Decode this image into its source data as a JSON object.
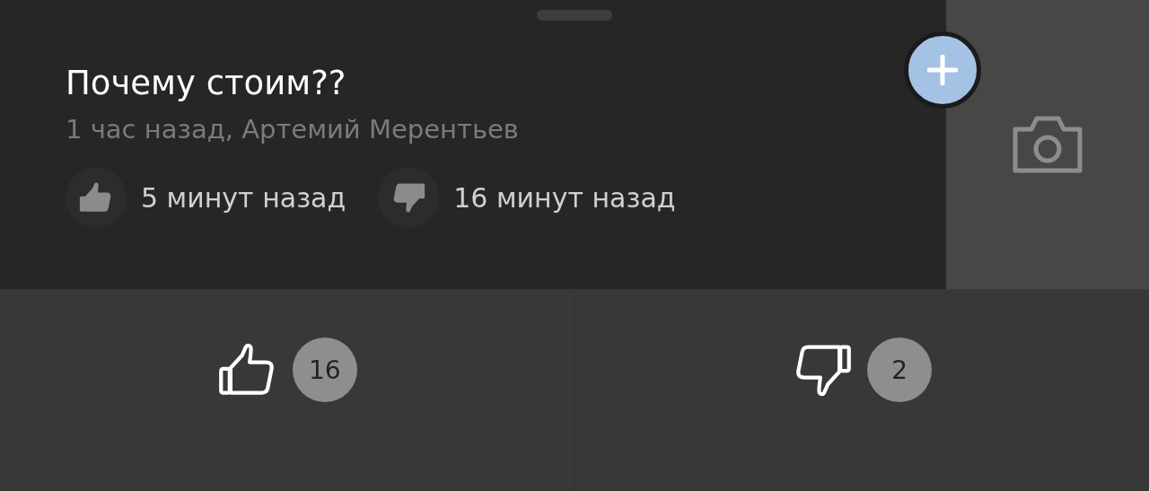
{
  "question": {
    "title": "Почему стоим??",
    "meta": "1 час назад, Артемий Мерентьев",
    "reactions": [
      {
        "kind": "like",
        "time": "5 минут назад"
      },
      {
        "kind": "dislike",
        "time": "16 минут назад"
      }
    ]
  },
  "vote_buttons": [
    {
      "kind": "like",
      "count": "16"
    },
    {
      "kind": "dislike",
      "count": "2"
    }
  ]
}
